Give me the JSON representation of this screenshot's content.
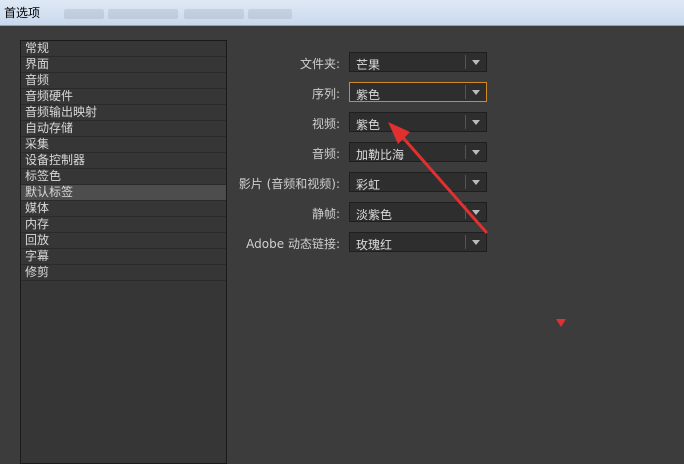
{
  "window": {
    "title": "首选项"
  },
  "sidebar": {
    "items": [
      {
        "label": "常规",
        "selected": false
      },
      {
        "label": "界面",
        "selected": false
      },
      {
        "label": "音频",
        "selected": false
      },
      {
        "label": "音频硬件",
        "selected": false
      },
      {
        "label": "音频输出映射",
        "selected": false
      },
      {
        "label": "自动存储",
        "selected": false
      },
      {
        "label": "采集",
        "selected": false
      },
      {
        "label": "设备控制器",
        "selected": false
      },
      {
        "label": "标签色",
        "selected": false
      },
      {
        "label": "默认标签",
        "selected": true
      },
      {
        "label": "媒体",
        "selected": false
      },
      {
        "label": "内存",
        "selected": false
      },
      {
        "label": "回放",
        "selected": false
      },
      {
        "label": "字幕",
        "selected": false
      },
      {
        "label": "修剪",
        "selected": false
      }
    ]
  },
  "settings": {
    "rows": [
      {
        "label": "文件夹:",
        "value": "芒果"
      },
      {
        "label": "序列:",
        "value": "紫色"
      },
      {
        "label": "视频:",
        "value": "紫色"
      },
      {
        "label": "音频:",
        "value": "加勒比海"
      },
      {
        "label": "影片 (音频和视频):",
        "value": "彩虹"
      },
      {
        "label": "静帧:",
        "value": "淡紫色"
      },
      {
        "label": "Adobe 动态链接:",
        "value": "玫瑰红"
      }
    ]
  },
  "colors": {
    "background": "#3c3c3c",
    "focus_border": "#d08a2a",
    "annotation_red": "#e03030"
  }
}
